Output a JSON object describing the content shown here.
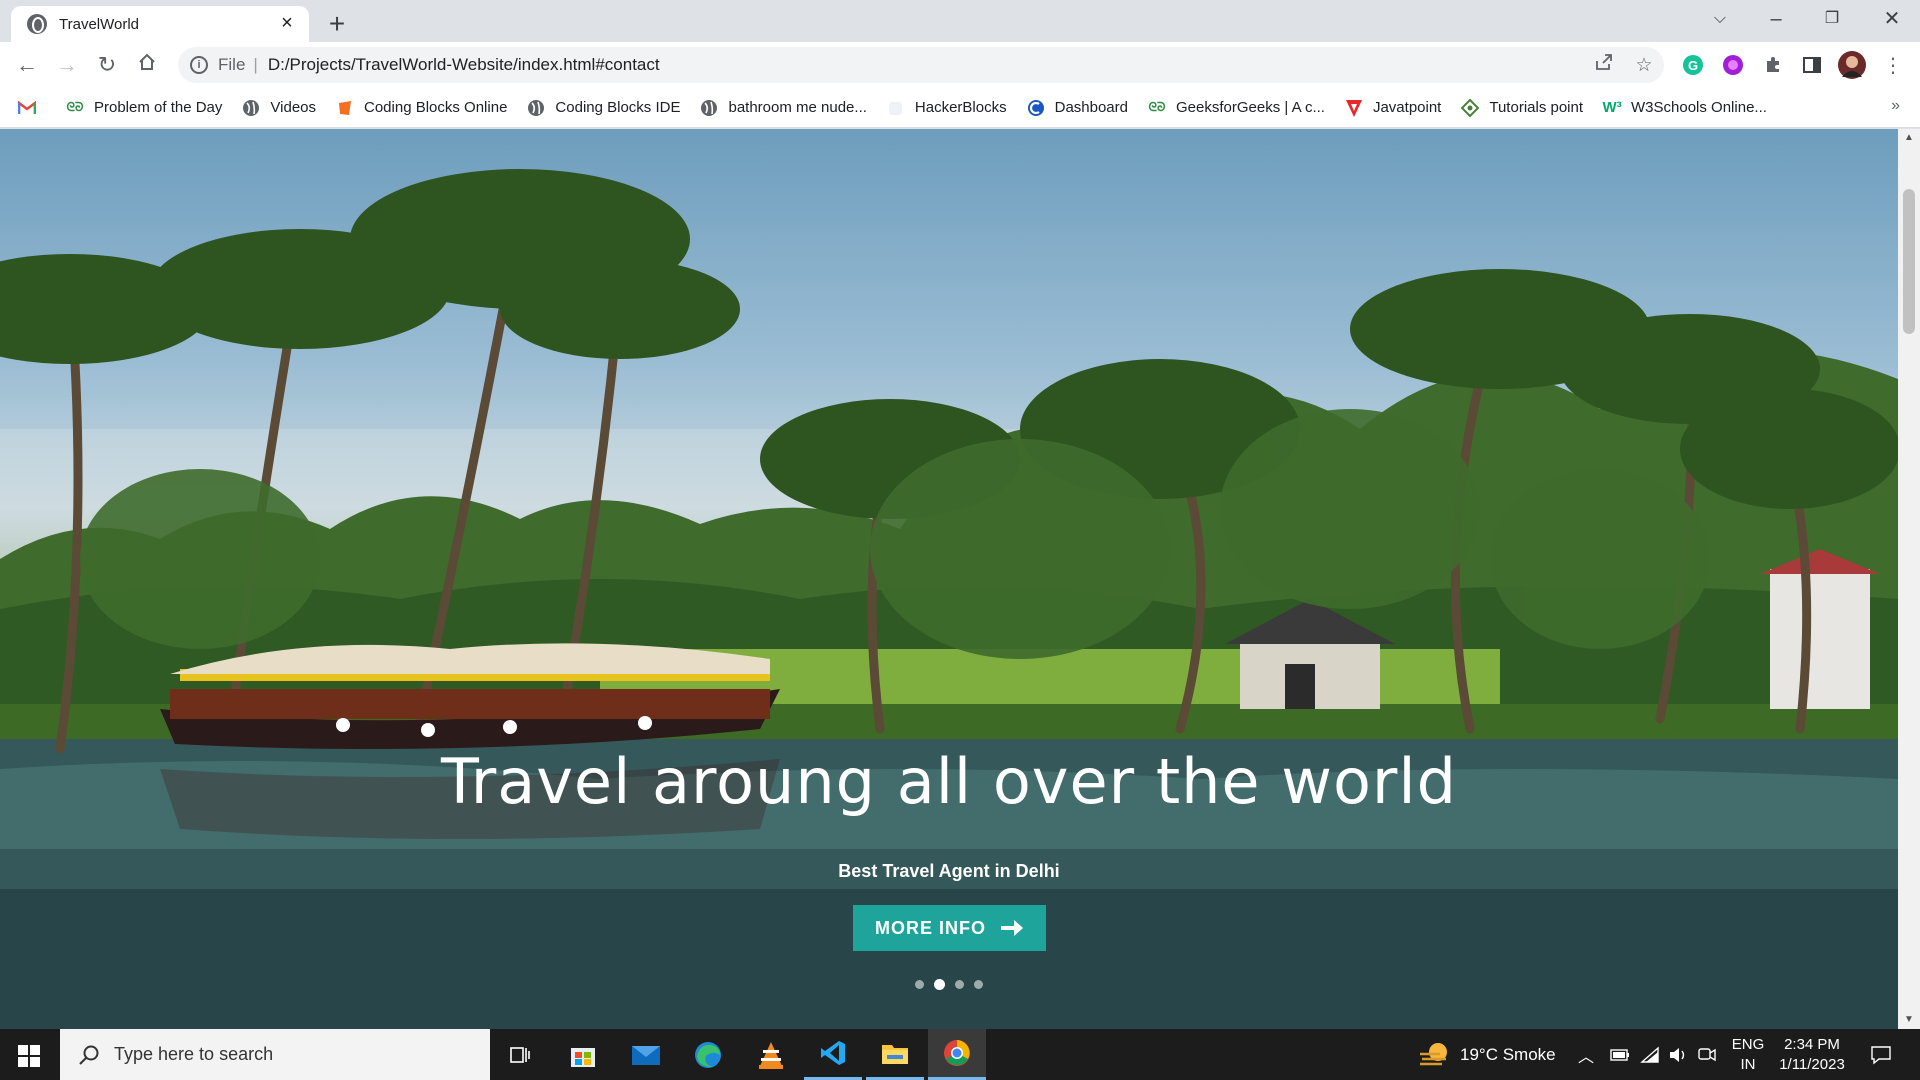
{
  "browser": {
    "tab_title": "TravelWorld",
    "url_scheme": "File",
    "url": "D:/Projects/TravelWorld-Website/index.html#contact"
  },
  "bookmarks": [
    {
      "label": "",
      "icon": "gmail-icon"
    },
    {
      "label": "Problem of the Day",
      "icon": "geeksforgeeks-icon"
    },
    {
      "label": "Videos",
      "icon": "globe-icon"
    },
    {
      "label": "Coding Blocks Online",
      "icon": "coding-blocks-icon"
    },
    {
      "label": "Coding Blocks IDE",
      "icon": "globe-icon"
    },
    {
      "label": "bathroom me nude...",
      "icon": "globe-icon"
    },
    {
      "label": "HackerBlocks",
      "icon": "hackerblocks-icon"
    },
    {
      "label": "Dashboard",
      "icon": "dashboard-icon"
    },
    {
      "label": "GeeksforGeeks | A c...",
      "icon": "geeksforgeeks-icon"
    },
    {
      "label": "Javatpoint",
      "icon": "javatpoint-icon"
    },
    {
      "label": "Tutorials point",
      "icon": "tutorialspoint-icon"
    },
    {
      "label": "W3Schools Online...",
      "icon": "w3schools-icon"
    }
  ],
  "hero": {
    "title": "Travel aroung all over the world",
    "subtitle": "Best Travel Agent in Delhi",
    "button_label": "MORE INFO",
    "slide_count": 4,
    "active_slide": 2,
    "accent_color": "#1ea49a"
  },
  "taskbar": {
    "search_placeholder": "Type here to search",
    "weather": "19°C  Smoke",
    "lang_line1": "ENG",
    "lang_line2": "IN",
    "time": "2:34 PM",
    "date": "1/11/2023"
  }
}
